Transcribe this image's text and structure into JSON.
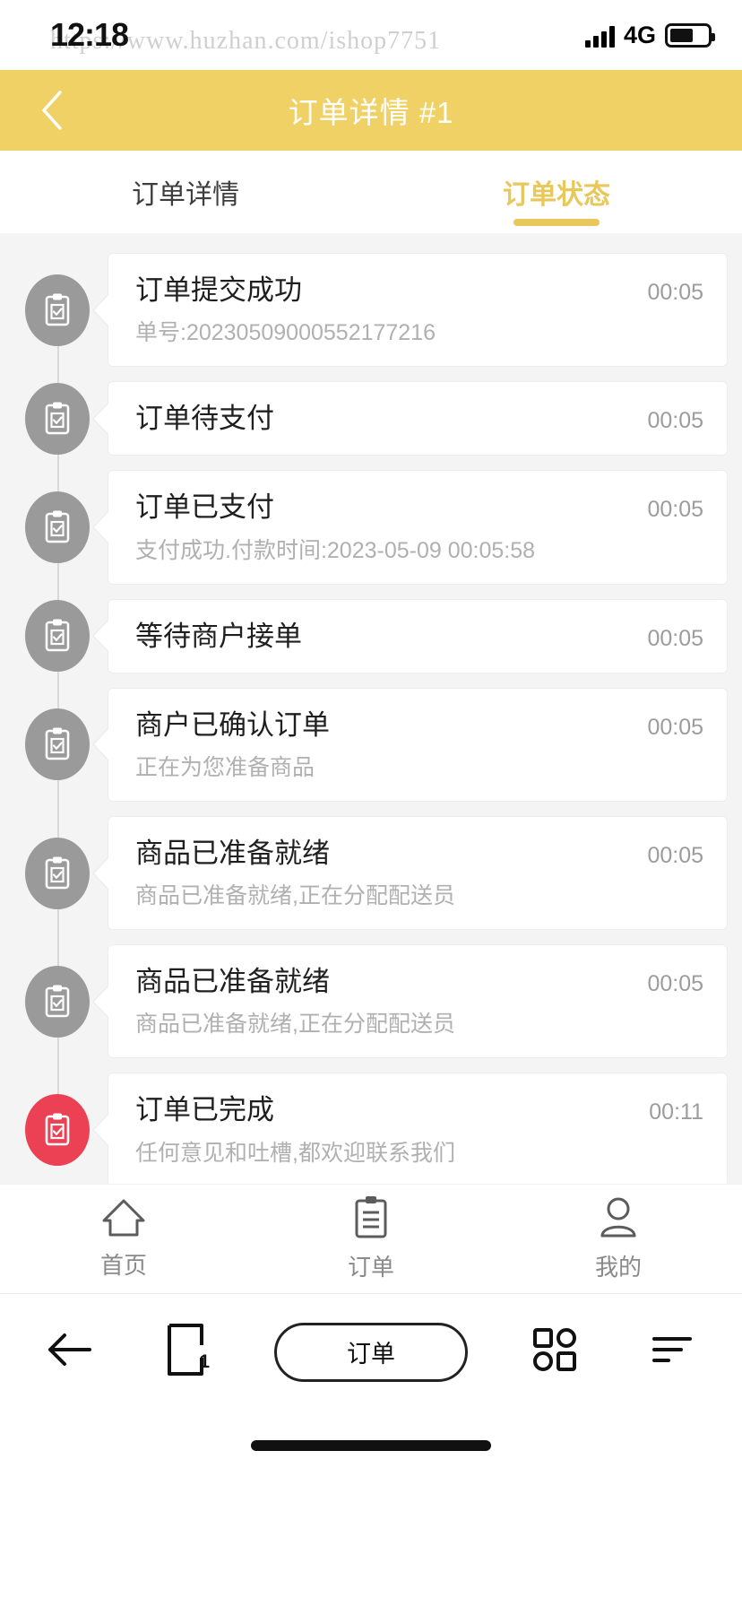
{
  "status_bar": {
    "time": "12:18",
    "watermark": "https://www.huzhan.com/ishop7751",
    "network": "4G",
    "signal_icon": "signal-bars-icon",
    "battery_icon": "battery-icon"
  },
  "header": {
    "back_icon": "chevron-left-icon",
    "title": "订单详情 #1",
    "background_color": "#efd165",
    "title_color": "#ffffff"
  },
  "tabs": {
    "active_color": "#e8c85a",
    "items": [
      {
        "label": "订单详情",
        "active": false
      },
      {
        "label": "订单状态",
        "active": true
      }
    ]
  },
  "timeline": {
    "icon": "clipboard-check-icon",
    "pending_color": "#9a9a9a",
    "done_color": "#ec4155",
    "items": [
      {
        "title": "订单提交成功",
        "subtitle": "单号:20230509000552177216",
        "time": "00:05",
        "state": "pending"
      },
      {
        "title": "订单待支付",
        "subtitle": "",
        "time": "00:05",
        "state": "pending"
      },
      {
        "title": "订单已支付",
        "subtitle": "支付成功.付款时间:2023-05-09 00:05:58",
        "time": "00:05",
        "state": "pending"
      },
      {
        "title": "等待商户接单",
        "subtitle": "",
        "time": "00:05",
        "state": "pending"
      },
      {
        "title": "商户已确认订单",
        "subtitle": "正在为您准备商品",
        "time": "00:05",
        "state": "pending"
      },
      {
        "title": "商品已准备就绪",
        "subtitle": "商品已准备就绪,正在分配配送员",
        "time": "00:05",
        "state": "pending"
      },
      {
        "title": "商品已准备就绪",
        "subtitle": "商品已准备就绪,正在分配配送员",
        "time": "00:05",
        "state": "pending"
      },
      {
        "title": "订单已完成",
        "subtitle": "任何意见和吐槽,都欢迎联系我们",
        "time": "00:11",
        "state": "done"
      }
    ]
  },
  "tabbar": {
    "items": [
      {
        "label": "首页",
        "icon": "home-icon"
      },
      {
        "label": "订单",
        "icon": "clipboard-list-icon"
      },
      {
        "label": "我的",
        "icon": "person-icon"
      }
    ]
  },
  "browser_bar": {
    "back_icon": "arrow-left-icon",
    "tabs_icon": "tab-switcher-icon",
    "tab_count": "1",
    "address_label": "订单",
    "apps_icon": "apps-grid-icon",
    "menu_icon": "menu-icon"
  }
}
